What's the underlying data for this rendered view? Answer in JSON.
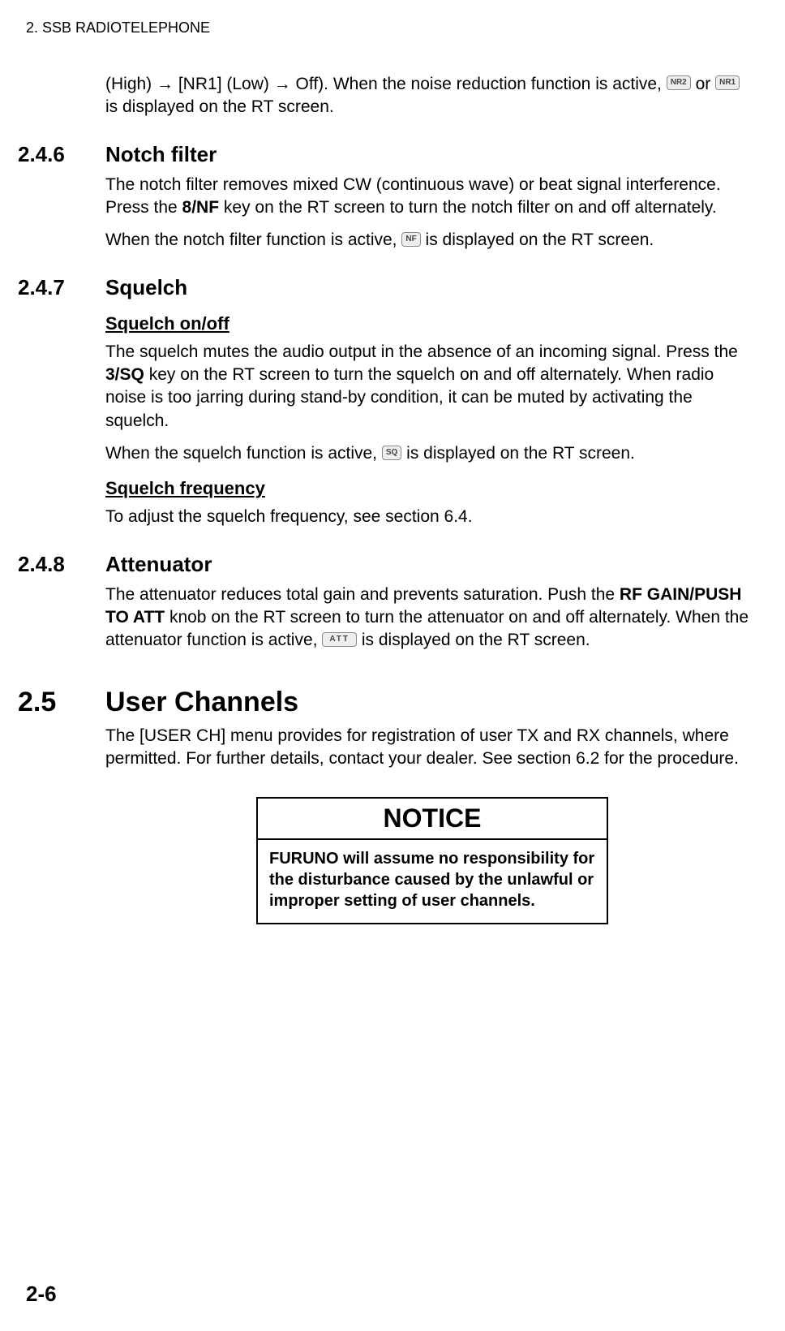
{
  "running_head": "2.  SSB RADIOTELEPHONE",
  "intro": {
    "line1_part1": "(High) → [NR1] (Low) → Off). When the noise reduction function is active, ",
    "icon1": "NR2",
    "line1_mid": " or ",
    "icon2": "NR1",
    "line2": "is displayed on the RT screen."
  },
  "s246": {
    "num": "2.4.6",
    "title": "Notch filter",
    "p1_a": "The notch filter removes mixed CW (continuous wave) or beat signal interference. Press the ",
    "p1_bold": "8/NF",
    "p1_b": " key on the RT screen to turn the notch filter on and off alternately.",
    "p2_a": "When the notch filter function is active, ",
    "icon": "NF",
    "p2_b": " is displayed on the RT screen."
  },
  "s247": {
    "num": "2.4.7",
    "title": "Squelch",
    "sub1": "Squelch on/off",
    "p1_a": "The squelch mutes the audio output in the absence of an incoming signal. Press the ",
    "p1_bold": "3/SQ",
    "p1_b": " key on the RT screen to turn the squelch on and off alternately. When radio noise is too jarring during stand-by condition, it can be muted by activating the squelch.",
    "p2_a": "When the squelch function is active, ",
    "icon": "SQ",
    "p2_b": " is displayed on the RT screen.",
    "sub2": "Squelch frequency",
    "p3": "To adjust the squelch frequency, see section 6.4."
  },
  "s248": {
    "num": "2.4.8",
    "title": "Attenuator",
    "p1_a": "The attenuator reduces total gain and prevents saturation. Push the ",
    "p1_bold": "RF GAIN/PUSH TO ATT",
    "p1_b": " knob on the RT screen to turn the attenuator on and off alternately. When the attenuator function is active, ",
    "icon": "ATT",
    "p1_c": " is displayed on the RT screen."
  },
  "s25": {
    "num": "2.5",
    "title": "User Channels",
    "p1": "The [USER CH] menu provides for registration of user TX and RX channels, where permitted. For further details, contact your dealer. See section 6.2 for the procedure."
  },
  "notice": {
    "head": "NOTICE",
    "body": "FURUNO will assume no responsibility for the disturbance caused by the unlawful or improper setting of user channels."
  },
  "page_number": "2-6"
}
